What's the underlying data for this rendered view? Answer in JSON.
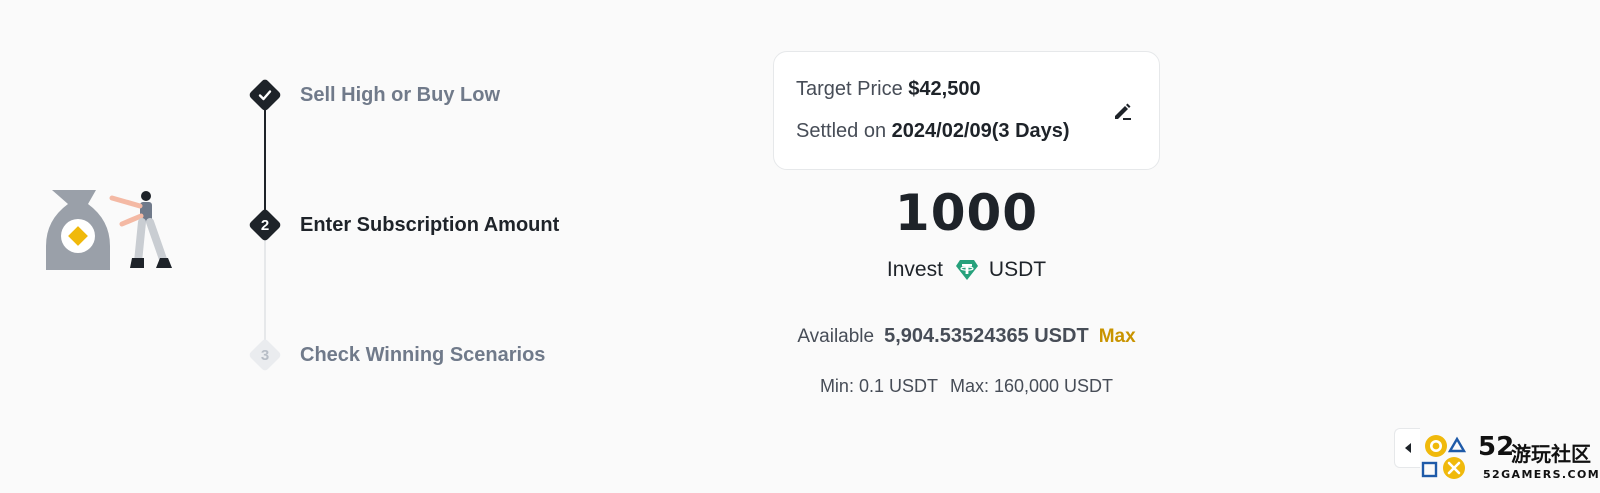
{
  "steps": [
    {
      "number": "",
      "title": "Sell High or Buy Low",
      "state": "done"
    },
    {
      "number": "2",
      "title": "Enter Subscription Amount",
      "state": "active"
    },
    {
      "number": "3",
      "title": "Check Winning Scenarios",
      "state": "pending"
    }
  ],
  "price_card": {
    "target_label": "Target Price",
    "target_value": "$42,500",
    "settled_label": "Settled on",
    "settled_value": "2024/02/09(3 Days)",
    "edit_icon": "edit-pencil-icon"
  },
  "amount": {
    "value": "1000",
    "invest_label": "Invest",
    "currency": "USDT",
    "currency_icon": "tether-icon"
  },
  "available": {
    "label": "Available",
    "value": "5,904.53524365 USDT",
    "max_label": "Max"
  },
  "limits": {
    "min": "Min: 0.1 USDT",
    "max": "Max: 160,000 USDT"
  },
  "watermark": {
    "number": "52",
    "name": "游玩社区",
    "site": "52GAMERS.COM"
  },
  "colors": {
    "text_primary": "#1E2329",
    "text_secondary": "#707A8A",
    "accent_yellow": "#F0B90B",
    "max_link": "#C99400",
    "tether_green": "#26A17B",
    "step_pending": "#EAECEF"
  }
}
